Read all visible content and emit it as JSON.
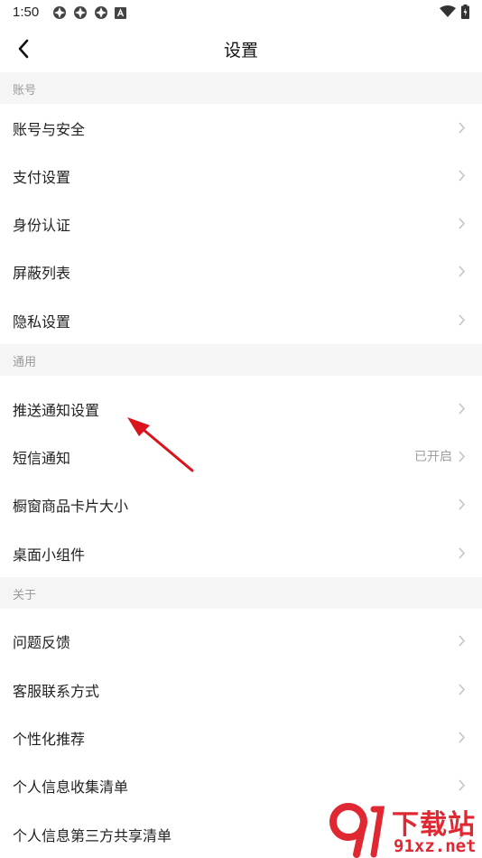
{
  "status": {
    "time": "1:50"
  },
  "header": {
    "title": "设置"
  },
  "sections": [
    {
      "title": "账号",
      "items": [
        {
          "label": "账号与安全"
        },
        {
          "label": "支付设置"
        },
        {
          "label": "身份认证"
        },
        {
          "label": "屏蔽列表"
        },
        {
          "label": "隐私设置"
        }
      ]
    },
    {
      "title": "通用",
      "items": [
        {
          "label": "推送通知设置"
        },
        {
          "label": "短信通知",
          "value": "已开启"
        },
        {
          "label": "橱窗商品卡片大小"
        },
        {
          "label": "桌面小组件"
        }
      ]
    },
    {
      "title": "关于",
      "items": [
        {
          "label": "问题反馈"
        },
        {
          "label": "客服联系方式"
        },
        {
          "label": "个性化推荐"
        },
        {
          "label": "个人信息收集清单"
        },
        {
          "label": "个人信息第三方共享清单"
        }
      ]
    }
  ],
  "watermark": {
    "title": "下载站",
    "url": "91xz.net"
  },
  "colors": {
    "annotation_arrow": "#d9141c",
    "watermark": "#e02832",
    "section_bg": "#f5f5f5"
  }
}
